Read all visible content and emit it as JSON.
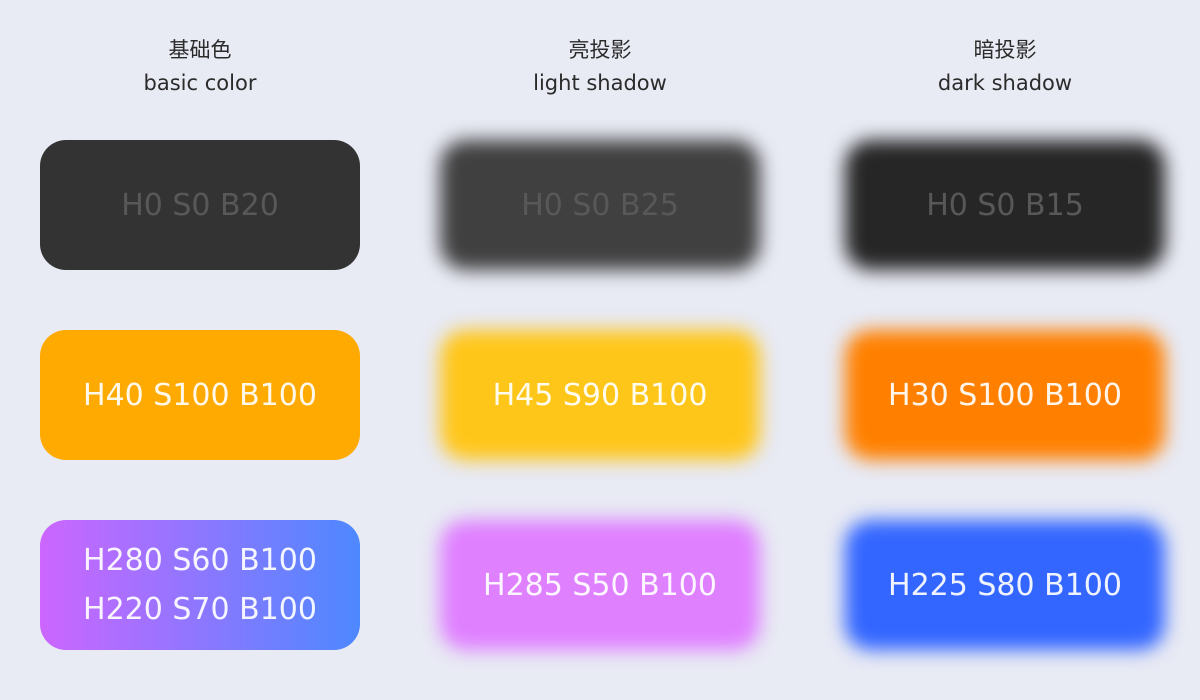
{
  "columns": [
    {
      "title_zh": "基础色",
      "title_en": "basic color"
    },
    {
      "title_zh": "亮投影",
      "title_en": "light shadow"
    },
    {
      "title_zh": "暗投影",
      "title_en": "dark shadow"
    }
  ],
  "rows": [
    {
      "basic": {
        "lines": [
          "H0 S0 B20"
        ],
        "color": "#333333"
      },
      "light": {
        "lines": [
          "H0 S0 B25"
        ],
        "color": "#404040"
      },
      "dark": {
        "lines": [
          "H0 S0 B15"
        ],
        "color": "#262626"
      }
    },
    {
      "basic": {
        "lines": [
          "H40 S100 B100"
        ],
        "color": "#ffaa00"
      },
      "light": {
        "lines": [
          "H45 S90 B100"
        ],
        "color": "#ffc61a"
      },
      "dark": {
        "lines": [
          "H30 S100 B100"
        ],
        "color": "#ff8000"
      }
    },
    {
      "basic": {
        "lines": [
          "H280 S60 B100",
          "H220 S70 B100"
        ],
        "gradient_from": "#cc66ff",
        "gradient_to": "#4d88ff"
      },
      "light": {
        "lines": [
          "H285 S50 B100"
        ],
        "color": "#df80ff"
      },
      "dark": {
        "lines": [
          "H225 S80 B100"
        ],
        "color": "#3366ff"
      }
    }
  ]
}
